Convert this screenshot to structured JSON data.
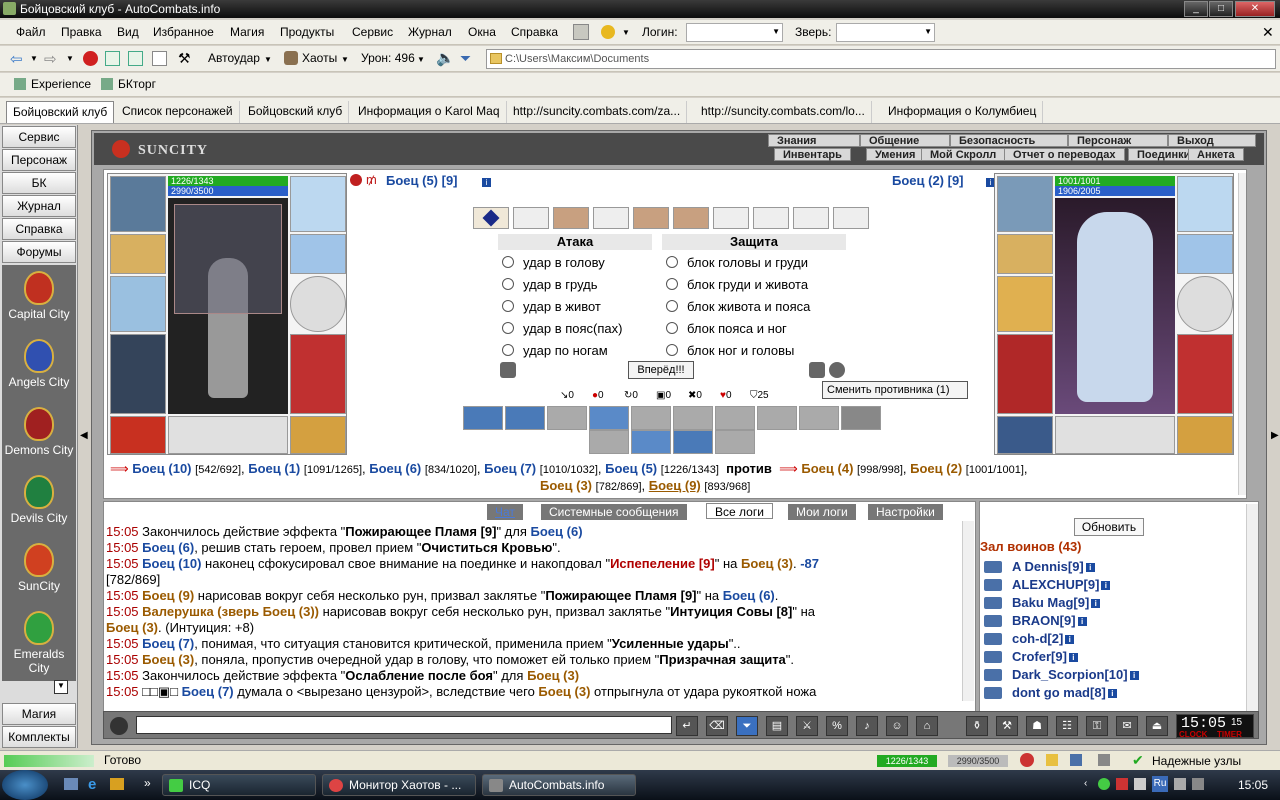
{
  "window": {
    "title": "Бойцовский клуб - AutoCombats.info",
    "buttons": [
      "_",
      "□",
      "✕"
    ]
  },
  "menu": {
    "items": [
      "Файл",
      "Правка",
      "Вид",
      "Избранное",
      "Магия",
      "Продукты",
      "Сервис",
      "Журнал",
      "Окна",
      "Справка"
    ],
    "login_label": "Логин:",
    "beast_label": "Зверь:"
  },
  "toolbar": {
    "autoudar": "Автоудар",
    "haoty": "Хаоты",
    "uron": "Урон: 496",
    "address": "C:\\Users\\Максим\\Documents"
  },
  "favorites": [
    "Experience",
    "БКторг"
  ],
  "tabs": [
    "Бойцовский клуб",
    "Список персонажей",
    "Бойцовский клуб",
    "Информация о Karol Maq",
    "http://suncity.combats.com/za...",
    "http://suncity.combats.com/lo...",
    "Информация о Колумбиец"
  ],
  "sidebar": {
    "buttons": [
      "Сервис",
      "Персонаж",
      "БК",
      "Журнал",
      "Справка",
      "Форумы"
    ],
    "cities": [
      {
        "name": "Capital City",
        "color": "#c03020"
      },
      {
        "name": "Angels City",
        "color": "#3050b0"
      },
      {
        "name": "Demons City",
        "color": "#a02020"
      },
      {
        "name": "Devils City",
        "color": "#208040"
      },
      {
        "name": "SunCity",
        "color": "#d04020"
      },
      {
        "name": "Emeralds City",
        "color": "#30a040"
      }
    ],
    "bottom": [
      "Магия",
      "Комплекты"
    ]
  },
  "game": {
    "logo": "SUNCITY",
    "nav_top": [
      "Знания",
      "Общение",
      "Безопасность",
      "Персонаж",
      "Выход"
    ],
    "nav_bottom": [
      "Инвентарь",
      "Умения",
      "Мой Скролл",
      "Отчет о переводах",
      "Поединки",
      "Анкета"
    ],
    "left_fighter": {
      "name": "Боец (5) [9]",
      "hp": "1226/1343",
      "mp": "2990/3500"
    },
    "right_fighter": {
      "name": "Боец (2) [9]",
      "hp": "1001/1001",
      "mp": "1906/2005"
    },
    "attack_title": "Атака",
    "defense_title": "Защита",
    "attacks": [
      "удар в голову",
      "удар в грудь",
      "удар в живот",
      "удар в пояс(пах)",
      "удар по ногам"
    ],
    "defenses": [
      "блок головы и груди",
      "блок груди и живота",
      "блок живота и пояса",
      "блок пояса и ног",
      "блок ног и головы"
    ],
    "forward_button": "Вперёд!!!",
    "change_tooltip": "Сменить противника (1)",
    "stats": [
      "0",
      "0",
      "0",
      "0",
      "0",
      "0",
      "25"
    ],
    "team_line1": [
      {
        "name": "Боец (10)",
        "hp": "[542/692]",
        "side": "a"
      },
      {
        "name": "Боец (1)",
        "hp": "[1091/1265]",
        "side": "a"
      },
      {
        "name": "Боец (6)",
        "hp": "[834/1020]",
        "side": "a"
      },
      {
        "name": "Боец (7)",
        "hp": "[1010/1032]",
        "side": "a"
      },
      {
        "name": "Боец (5)",
        "hp": "[1226/1343]",
        "side": "a"
      }
    ],
    "versus": "против",
    "team_line2": [
      {
        "name": "Боец (4)",
        "hp": "[998/998]",
        "side": "b"
      },
      {
        "name": "Боец (2)",
        "hp": "[1001/1001]",
        "side": "b"
      }
    ],
    "team_line3": [
      {
        "name": "Боец (3)",
        "hp": "[782/869]",
        "side": "b"
      },
      {
        "name": "Боец (9)",
        "hp": "[893/968]",
        "side": "b"
      }
    ]
  },
  "log": {
    "tabs": [
      "Чат",
      "Системные сообщения",
      "Все логи",
      "Мои логи",
      "Настройки"
    ],
    "lines": [
      {
        "time": "15:05",
        "html": "Закончилось действие эффекта \"<b>Пожирающее Пламя [9]</b>\" для <span class='nm'>Боец (6)</span>"
      },
      {
        "time": "15:05",
        "html": "<span class='nm'>Боец (6)</span>, решив стать героем, провел прием \"<b>Очиститься Кровью</b>\"."
      },
      {
        "time": "15:05",
        "html": "<span class='nm'>Боец (10)</span> наконец сфокусировал свое внимание на поединке и накопдовал \"<span class='rd'>Испепеление [9]</span>\" на <span class='nmb'>Боец (3)</span>. <span class='nm'>-87</span>"
      },
      {
        "time": "",
        "html": "[782/869]"
      },
      {
        "time": "15:05",
        "html": "<span class='nmb'>Боец (9)</span> нарисовав вокруг себя несколько рун, призвал заклятье \"<b>Пожирающее Пламя [9]</b>\" на <span class='nm'>Боец (6)</span>."
      },
      {
        "time": "15:05",
        "html": "<span class='nmb'>Валерушка (зверь Боец (3))</span> нарисовав вокруг себя несколько рун, призвал заклятье \"<b>Интуиция Совы [8]</b>\" на"
      },
      {
        "time": "",
        "html": "<span class='nmb'>Боец (3)</span>. (Интуиция: +8)"
      },
      {
        "time": "15:05",
        "html": "<span class='nm'>Боец (7)</span>, понимая, что ситуация становится критической, применила прием \"<b>Усиленные удары</b>\".."
      },
      {
        "time": "15:05",
        "html": "<span class='nmb'>Боец (3)</span>, поняла, пропустив очередной удар в голову, что поможет ей только прием \"<b>Призрачная защита</b>\"."
      },
      {
        "time": "15:05",
        "html": "Закончилось действие эффекта \"<b>Ослабление после боя</b>\" для <span class='nmb'>Боец (3)</span>"
      },
      {
        "time": "15:05",
        "html": "□□▣□ <span class='nm'>Боец (7)</span> думала о &lt;вырезано цензурой&gt;, вследствие чего <span class='nmb'>Боец (3)</span> отпрыгнула от удара рукояткой ножа"
      }
    ]
  },
  "hall": {
    "refresh": "Обновить",
    "title": "Зал воинов (43)",
    "players": [
      "A Dennis[9]",
      "ALEXCHUP[9]",
      "Baku Mag[9]",
      "BRAON[9]",
      "coh-d[2]",
      "Crofer[9]",
      "Dark_Scorpion[10]",
      "dont go mad[8]"
    ]
  },
  "clock": {
    "time": "15:05",
    "sec": "15",
    "labels": [
      "CLOCK",
      "TIMER"
    ]
  },
  "status": {
    "text": "Готово",
    "hp": "1226/1343",
    "mp": "2990/3500",
    "zone": "Надежные узлы"
  },
  "taskbar": {
    "tasks": [
      "ICQ",
      "Монитор Хаотов - ...",
      "AutoCombats.info"
    ],
    "lang": "Ru",
    "time": "15:05"
  }
}
